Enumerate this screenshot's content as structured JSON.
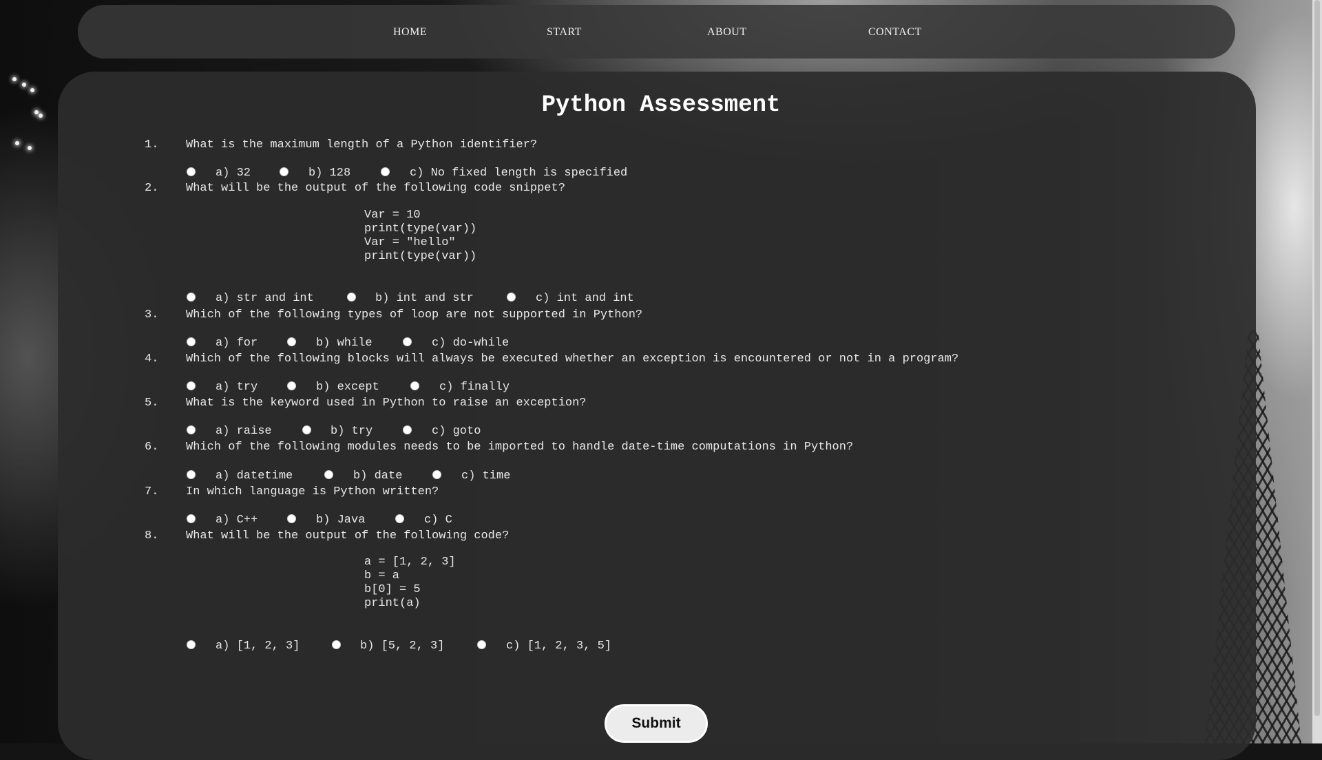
{
  "nav": {
    "home": "HOME",
    "start": "START",
    "about": "ABOUT",
    "contact": "CONTACT"
  },
  "title": "Python Assessment",
  "questions": [
    {
      "number": "1.",
      "text": "What is the maximum length of a Python identifier?",
      "options": [
        "a) 32",
        "b) 128",
        "c) No fixed length is specified"
      ]
    },
    {
      "number": "2.",
      "text": "What will be the output of the following code snippet?",
      "code": [
        "Var = 10",
        "print(type(var))",
        "Var = \"hello\"",
        "print(type(var))"
      ],
      "options": [
        "a) str and int",
        "b) int and str",
        "c) int and int"
      ]
    },
    {
      "number": "3.",
      "text": "Which of the following types of loop are not supported in Python?",
      "options": [
        "a) for",
        "b) while",
        "c) do-while"
      ]
    },
    {
      "number": "4.",
      "text": "Which of the following blocks will always be executed whether an exception is encountered or not in a program?",
      "options": [
        "a) try",
        "b) except",
        "c) finally"
      ]
    },
    {
      "number": "5.",
      "text": "What is the keyword used in Python to raise an exception?",
      "options": [
        "a) raise",
        "b) try",
        "c) goto"
      ]
    },
    {
      "number": "6.",
      "text": "Which of the following modules needs to be imported to handle date-time computations in Python?",
      "options": [
        "a) datetime",
        "b) date",
        "c) time"
      ]
    },
    {
      "number": "7.",
      "text": "In which language is Python written?",
      "options": [
        "a) C++",
        "b) Java",
        "c) C"
      ]
    },
    {
      "number": "8.",
      "text": "What will be the output of the following code?",
      "code": [
        "a = [1, 2, 3]",
        "b = a",
        "b[0] = 5",
        "print(a)"
      ],
      "options": [
        "a) [1, 2, 3]",
        "b) [5, 2, 3]",
        "c) [1, 2, 3, 5]"
      ]
    }
  ],
  "submit_label": "Submit",
  "colors": {
    "panel": "#2c2c2c",
    "navbar": "#383838",
    "text": "#e8e8e8",
    "button": "#ececec"
  }
}
